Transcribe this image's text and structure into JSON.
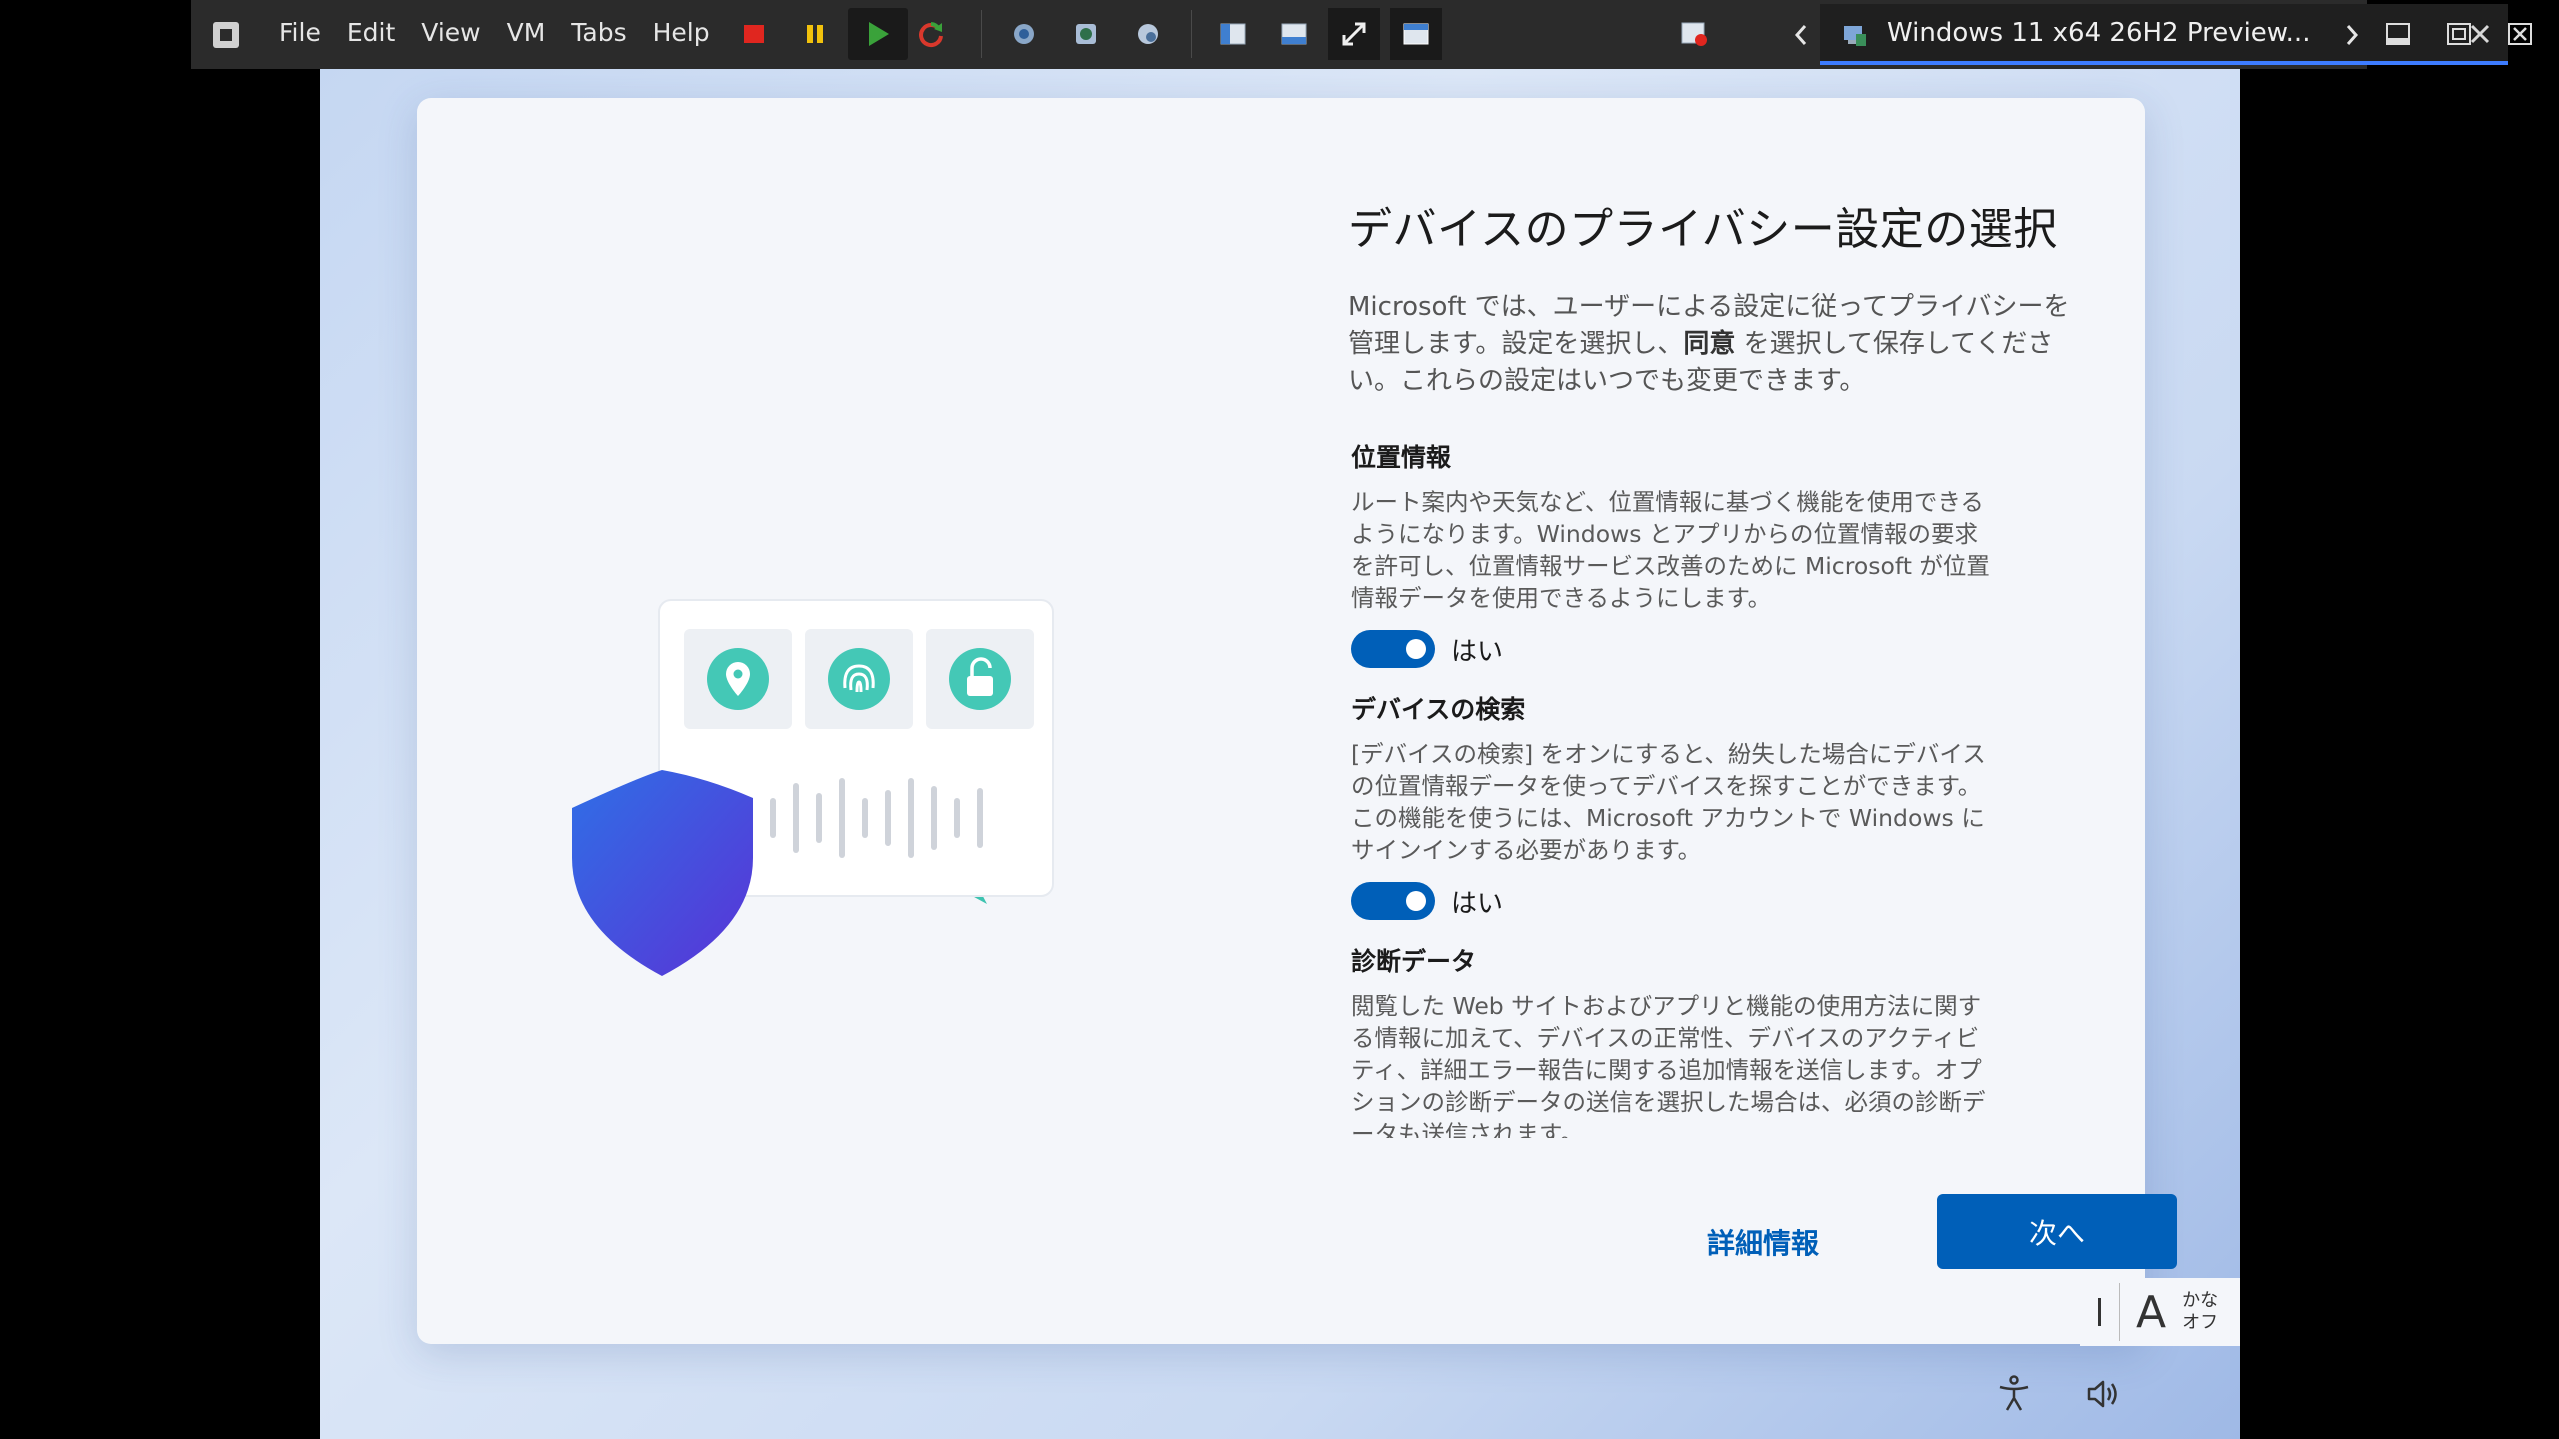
{
  "toolbar": {
    "menu": [
      "File",
      "Edit",
      "View",
      "VM",
      "Tabs",
      "Help"
    ],
    "tab_title": "Windows 11 x64 26H2 Preview..."
  },
  "oobe": {
    "title": "デバイスのプライバシー設定の選択",
    "description_parts": [
      "Microsoft では、ユーザーによる設定に従ってプライバシーを管理します。設定を選択し、",
      "同意",
      " を選択して保存してください。これらの設定はいつでも変更できます。"
    ],
    "sections": [
      {
        "title": "位置情報",
        "body": "ルート案内や天気など、位置情報に基づく機能を使用できるようになります。Windows とアプリからの位置情報の要求を許可し、位置情報サービス改善のために Microsoft が位置情報データを使用できるようにします。",
        "toggle_label": "はい",
        "toggle_on": true
      },
      {
        "title": "デバイスの検索",
        "body": "[デバイスの検索] をオンにすると、紛失した場合にデバイスの位置情報データを使ってデバイスを探すことができます。この機能を使うには、Microsoft アカウントで Windows にサインインする必要があります。",
        "toggle_label": "はい",
        "toggle_on": true
      },
      {
        "title": "診断データ",
        "body": "閲覧した Web サイトおよびアプリと機能の使用方法に関する情報に加えて、デバイスの正常性、デバイスのアクティビティ、詳細エラー報告に関する追加情報を送信します。オプションの診断データの送信を選択した場合は、必須の診断データも送信されます。"
      }
    ],
    "more_info_label": "詳細情報",
    "next_label": "次へ"
  },
  "ime": {
    "mode_letter": "A",
    "line1": "かな",
    "line2": "オフ"
  },
  "colors": {
    "accent": "#005fb8",
    "teal": "#3fc8b4",
    "shield": "#3b4fd8"
  }
}
